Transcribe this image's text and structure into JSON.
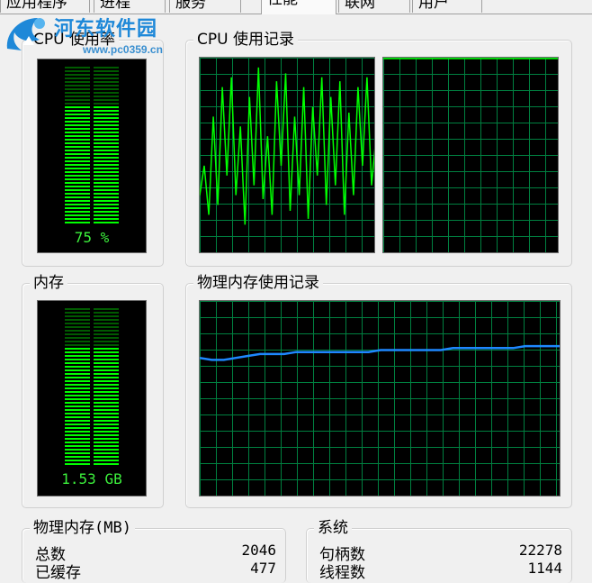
{
  "tabs": [
    {
      "label": "应用程序",
      "active": false
    },
    {
      "label": "进程",
      "active": false
    },
    {
      "label": "服务",
      "active": false
    },
    {
      "label": "性能",
      "active": true
    },
    {
      "label": "联网",
      "active": false
    },
    {
      "label": "用户",
      "active": false
    }
  ],
  "watermark": {
    "title": "河东软件园",
    "url": "www.pc0359.cn"
  },
  "cpu_usage": {
    "title": "CPU 使用率",
    "value_text": "75 %",
    "percent": 75
  },
  "cpu_history": {
    "title": "CPU 使用记录"
  },
  "memory": {
    "title": "内存",
    "value_text": "1.53 GB",
    "percent": 75
  },
  "memory_history": {
    "title": "物理内存使用记录"
  },
  "physical_memory": {
    "title": "物理内存(MB)",
    "rows": [
      {
        "label": "总数",
        "value": "2046"
      },
      {
        "label": "已缓存",
        "value": "477"
      }
    ]
  },
  "system": {
    "title": "系统",
    "rows": [
      {
        "label": "句柄数",
        "value": "22278"
      },
      {
        "label": "线程数",
        "value": "1144"
      }
    ]
  },
  "colors": {
    "graph_bg": "#000000",
    "grid": "#008040",
    "cpu_line": "#00ff00",
    "mem_line": "#1e88ff",
    "meter_on": "#00ff00",
    "meter_off": "#005a00"
  }
}
